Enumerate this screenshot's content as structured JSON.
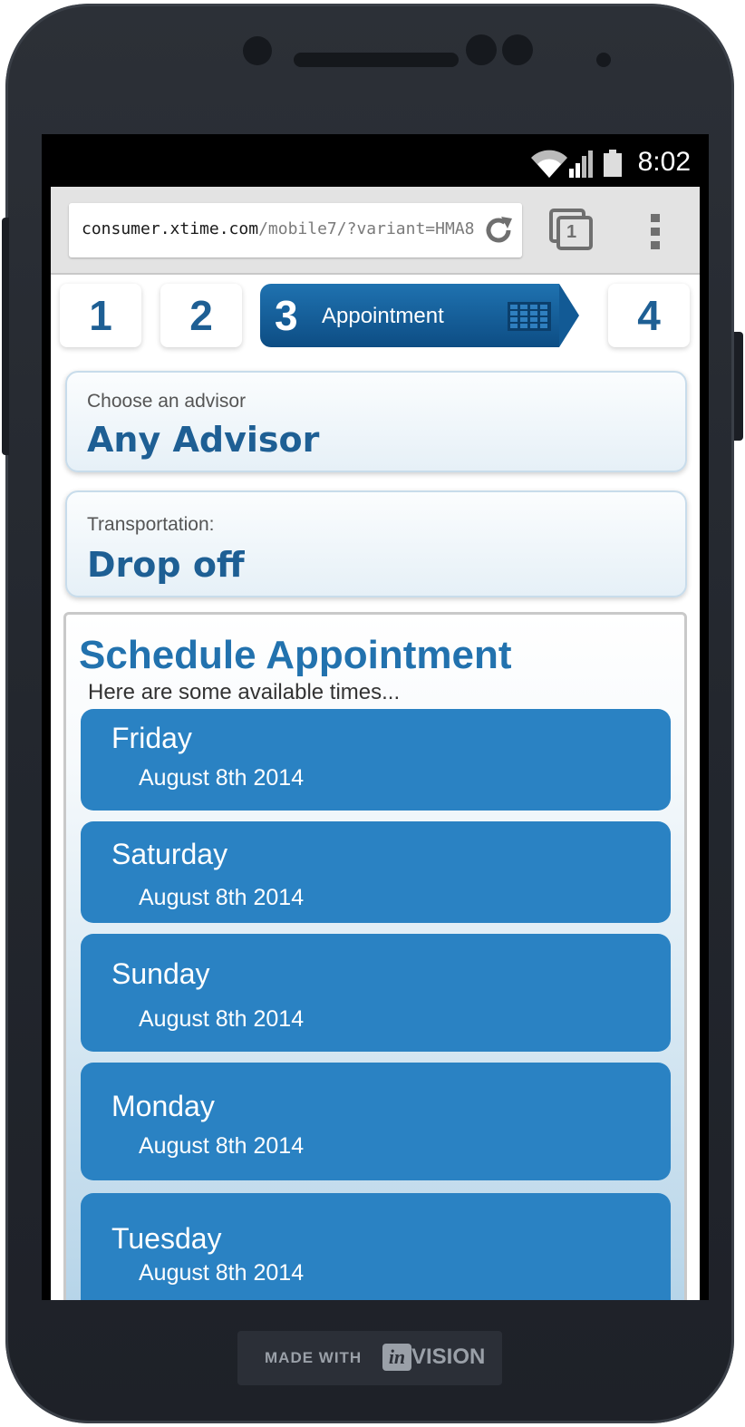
{
  "status_bar": {
    "time": "8:02"
  },
  "browser": {
    "url_host": "consumer.xtime.com",
    "url_path": "/mobile7/?variant=HMA8",
    "tab_count": "1"
  },
  "steps": {
    "step1": "1",
    "step2": "2",
    "step3_number": "3",
    "step3_label": "Appointment",
    "step4": "4"
  },
  "advisor": {
    "label": "Choose an advisor",
    "value": "Any Advisor"
  },
  "transportation": {
    "label": "Transportation:",
    "value": "Drop off"
  },
  "schedule": {
    "title": "Schedule Appointment",
    "subtitle": "Here are some available times...",
    "days": [
      {
        "day": "Friday",
        "date": "August 8th 2014"
      },
      {
        "day": "Saturday",
        "date": "August 8th 2014"
      },
      {
        "day": "Sunday",
        "date": "August 8th 2014"
      },
      {
        "day": "Monday",
        "date": "August 8th 2014"
      },
      {
        "day": "Tuesday",
        "date": "August 8th 2014"
      }
    ]
  },
  "footer": {
    "made_with": "MADE WITH",
    "logo": "in",
    "vision": "VISION"
  },
  "colors": {
    "accent": "#1e5f94",
    "day_button": "#2a82c3",
    "phone_body": "#23272e"
  },
  "icons": [
    "wifi-icon",
    "signal-icon",
    "battery-icon",
    "reload-icon",
    "tabs-icon",
    "overflow-menu-icon",
    "calendar-icon"
  ]
}
